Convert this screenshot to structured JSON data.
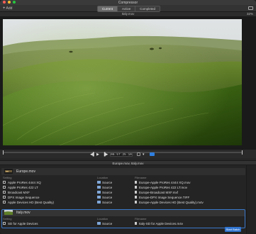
{
  "window": {
    "title": "Compressor"
  },
  "toolbar": {
    "add_label": "Add",
    "tabs": [
      {
        "label": "Current",
        "active": true
      },
      {
        "label": "Active",
        "active": false
      },
      {
        "label": "Completed",
        "active": false
      }
    ]
  },
  "viewer": {
    "file_name": "Italy.mov",
    "zoom": "32%"
  },
  "transport": {
    "timecode": "06:57:25:10",
    "progress": 0.0
  },
  "batch": {
    "name": "Europe.mov, Italy.mov"
  },
  "jobs": [
    {
      "name": "Europe.mov",
      "columns": {
        "setting": "Setting",
        "location": "Location",
        "filename": "Filename"
      },
      "rows": [
        {
          "setting": "Apple ProRes 4444 XQ",
          "location": "Source",
          "filename": "Europe-Apple ProRes 4444 XQ.mov"
        },
        {
          "setting": "Apple ProRes 422 LT",
          "location": "Source",
          "filename": "Europe-Apple ProRes 422 LT.mov"
        },
        {
          "setting": "Broadcast MXF",
          "location": "Source",
          "filename": "Europe-Broadcast MXF.mxf"
        },
        {
          "setting": "DPX Image Sequence",
          "location": "Source",
          "filename": "Europe-DPX Image Sequence.TIFF"
        },
        {
          "setting": "Apple Devices HD (Best Quality)",
          "location": "Source",
          "filename": "Europe-Apple Devices HD (Best Quality).m4v"
        }
      ]
    },
    {
      "name": "Italy.mov",
      "columns": {
        "setting": "Setting",
        "location": "Location",
        "filename": "Filename"
      },
      "rows": [
        {
          "setting": "SD for Apple Devices",
          "location": "Source",
          "filename": "Italy-SD for Apple Devices.m4v"
        }
      ]
    }
  ],
  "footer": {
    "start_label": "Start Batch"
  },
  "colors": {
    "accent": "#2f74d0",
    "background": "#262626"
  }
}
